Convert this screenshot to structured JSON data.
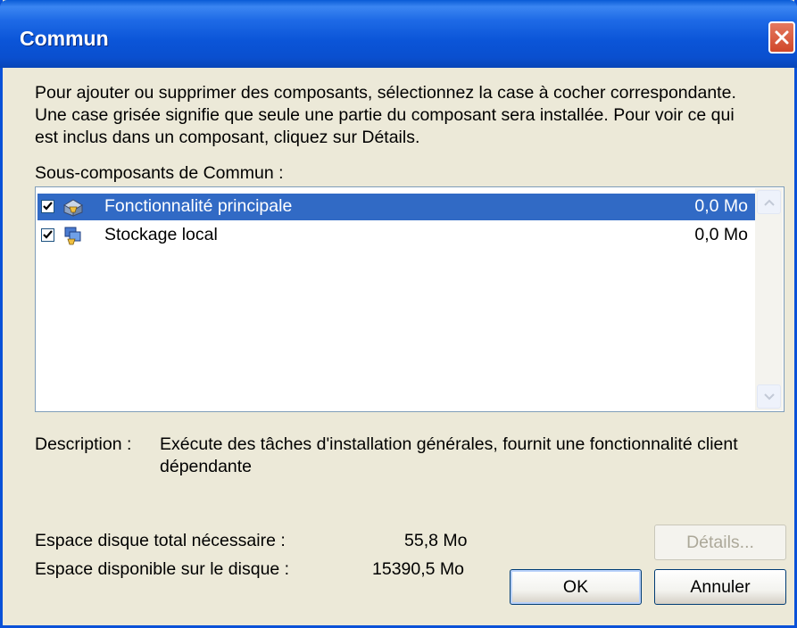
{
  "window": {
    "title": "Commun"
  },
  "intro_text": "Pour ajouter ou supprimer des composants, sélectionnez la case à cocher correspondante. Une case grisée signifie que seule une partie du composant sera installée. Pour voir ce qui est inclus dans un composant, cliquez sur Détails.",
  "subcomponents_label": "Sous-composants de Commun :",
  "components": [
    {
      "label": "Fonctionnalité principale",
      "size": "0,0 Mo",
      "checked": true,
      "selected": true,
      "icon": "package-icon"
    },
    {
      "label": "Stockage local",
      "size": "0,0 Mo",
      "checked": true,
      "selected": false,
      "icon": "storage-icon"
    }
  ],
  "description": {
    "label": "Description :",
    "text": "Exécute des tâches d'installation générales, fournit une fonctionnalité client dépendante"
  },
  "disk": {
    "total_label": "Espace disque total nécessaire :",
    "total_value": "55,8 Mo",
    "available_label": "Espace disponible sur le disque :",
    "available_value": "15390,5 Mo"
  },
  "buttons": {
    "details": "Détails...",
    "ok": "OK",
    "cancel": "Annuler"
  },
  "colors": {
    "selection": "#316ac5",
    "titlebar": "#0a5bd6",
    "dialog_bg": "#ece9d8"
  }
}
